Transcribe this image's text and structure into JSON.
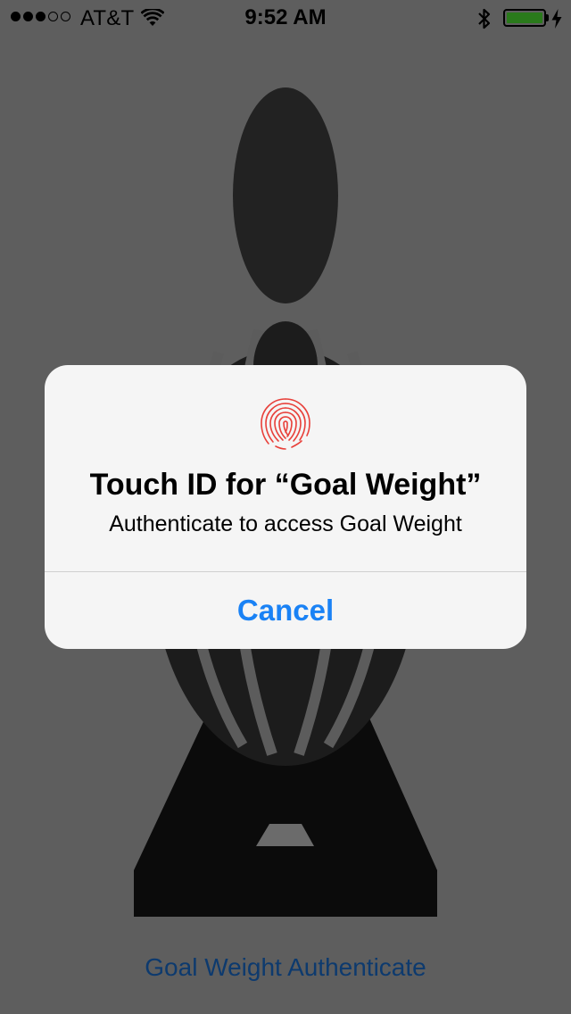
{
  "status_bar": {
    "carrier": "AT&T",
    "time": "9:52 AM",
    "signal_bars_filled": 3,
    "signal_bars_total": 5
  },
  "app": {
    "authenticate_link": "Goal Weight Authenticate"
  },
  "alert": {
    "icon": "fingerprint-icon",
    "title": "Touch ID for “Goal Weight”",
    "message": "Authenticate to access Goal Weight",
    "cancel_label": "Cancel"
  },
  "colors": {
    "background": "#5e5e5e",
    "alert_background": "#f5f5f5",
    "cancel_blue": "#1a82f5",
    "link_blue": "#0d3a6e",
    "fingerprint_red": "#e8403a",
    "battery_green": "#2a7a1b"
  }
}
